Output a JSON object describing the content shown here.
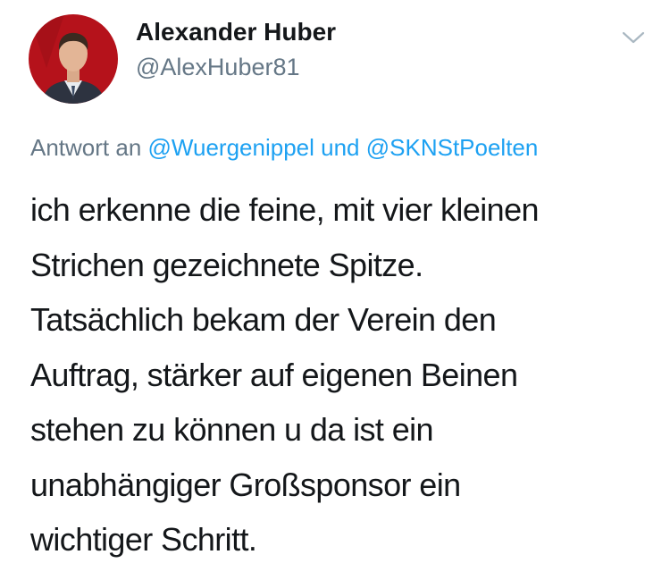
{
  "tweet": {
    "author": {
      "display_name": "Alexander Huber",
      "handle": "@AlexHuber81",
      "avatar_icon": "profile-photo"
    },
    "menu_icon": "chevron-down-icon",
    "reply_context": {
      "prefix": "Antwort an",
      "mention_1": "@Wuergenippel",
      "conjunction": "und",
      "mention_2": "@SKNStPoelten"
    },
    "text_lines": [
      "ich erkenne die feine, mit vier kleinen",
      "Strichen gezeichnete Spitze.",
      "Tatsächlich bekam der Verein den",
      "Auftrag, stärker auf eigenen Beinen",
      "stehen zu können u da ist ein",
      "unabhängiger Großsponsor ein",
      "wichtiger Schritt."
    ]
  },
  "colors": {
    "text": "#14171a",
    "secondary": "#657786",
    "link": "#1da1f2",
    "avatar_background": "#b5121b"
  }
}
